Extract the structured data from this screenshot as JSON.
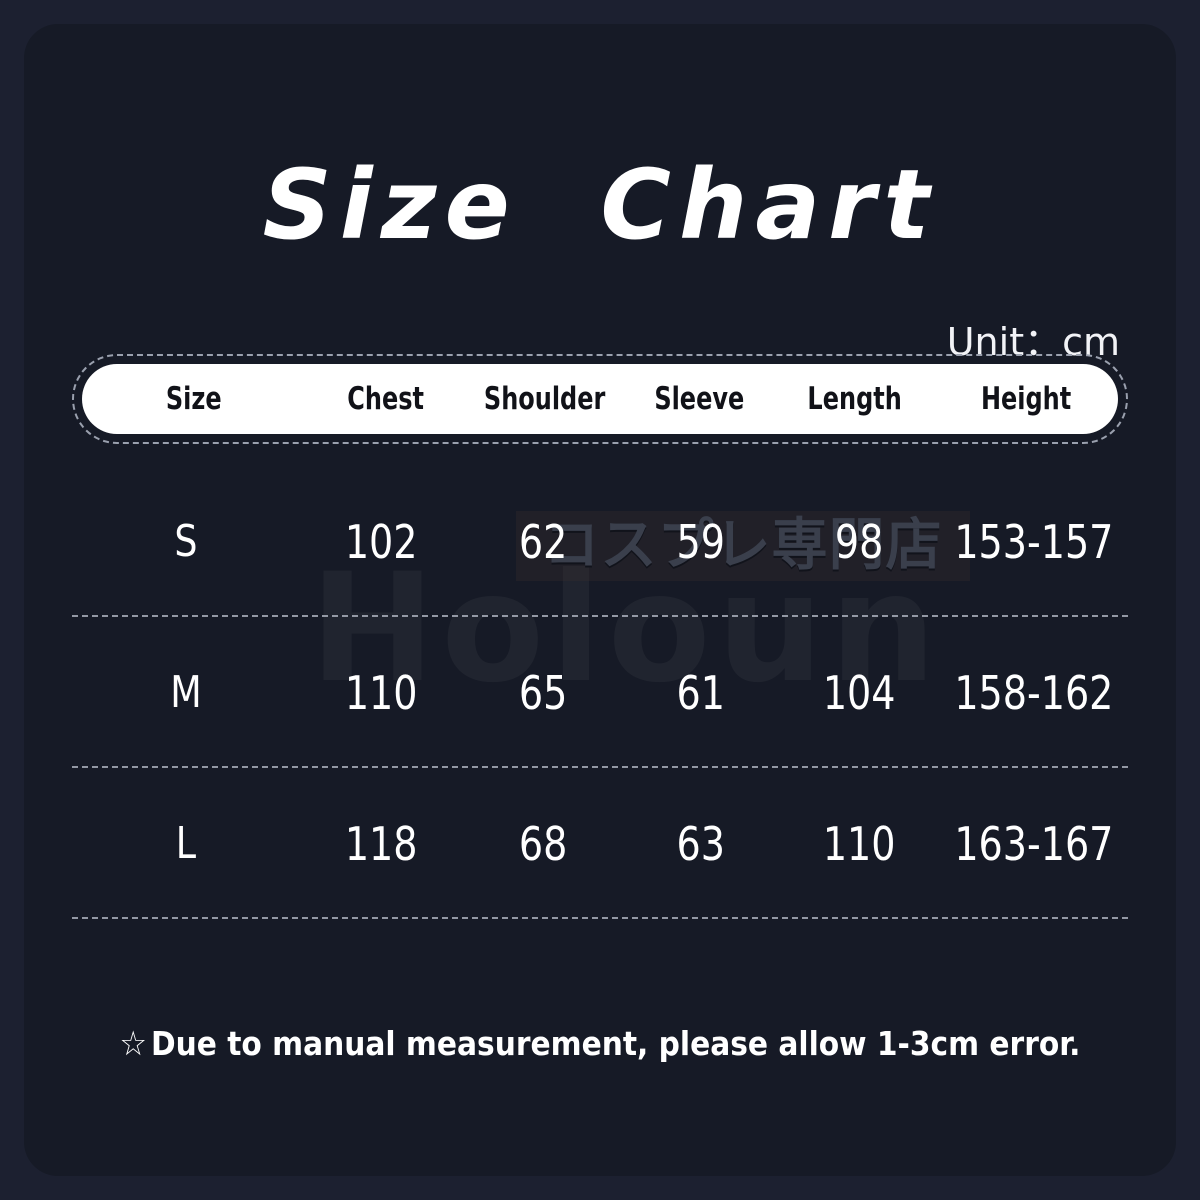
{
  "title": "Size  Chart",
  "unit_label": "Unit：cm",
  "watermarks": {
    "brand": "Holoun",
    "shop_jp": "コスプレ専門店"
  },
  "table": {
    "columns": [
      "Size",
      "Chest",
      "Shoulder",
      "Sleeve",
      "Length",
      "Height"
    ],
    "rows": [
      {
        "size": "S",
        "chest": "102",
        "shoulder": "62",
        "sleeve": "59",
        "length": "98",
        "height": "153-157"
      },
      {
        "size": "M",
        "chest": "110",
        "shoulder": "65",
        "sleeve": "61",
        "length": "104",
        "height": "158-162"
      },
      {
        "size": "L",
        "chest": "118",
        "shoulder": "68",
        "sleeve": "63",
        "length": "110",
        "height": "163-167"
      }
    ]
  },
  "footer": {
    "star": "☆",
    "note": "Due to manual measurement, please allow 1-3cm error."
  },
  "colors": {
    "outer_background": "#1c2030",
    "panel_background": "#161a26",
    "header_pill": "#ffffff",
    "header_text": "#111218",
    "body_text": "#ffffff",
    "divider": "#a9aeba",
    "watermark": "#20242f"
  },
  "chart_data": {
    "type": "table",
    "title": "Size  Chart",
    "subtitle": "Unit：cm",
    "columns": [
      "Size",
      "Chest",
      "Shoulder",
      "Sleeve",
      "Length",
      "Height"
    ],
    "units": "cm",
    "rows": [
      [
        "S",
        "102",
        "62",
        "59",
        "98",
        "153-157"
      ],
      [
        "M",
        "110",
        "65",
        "61",
        "104",
        "158-162"
      ],
      [
        "L",
        "118",
        "68",
        "63",
        "110",
        "163-167"
      ]
    ],
    "annotations": [
      "☆Due to manual measurement, please allow 1-3cm error."
    ]
  }
}
